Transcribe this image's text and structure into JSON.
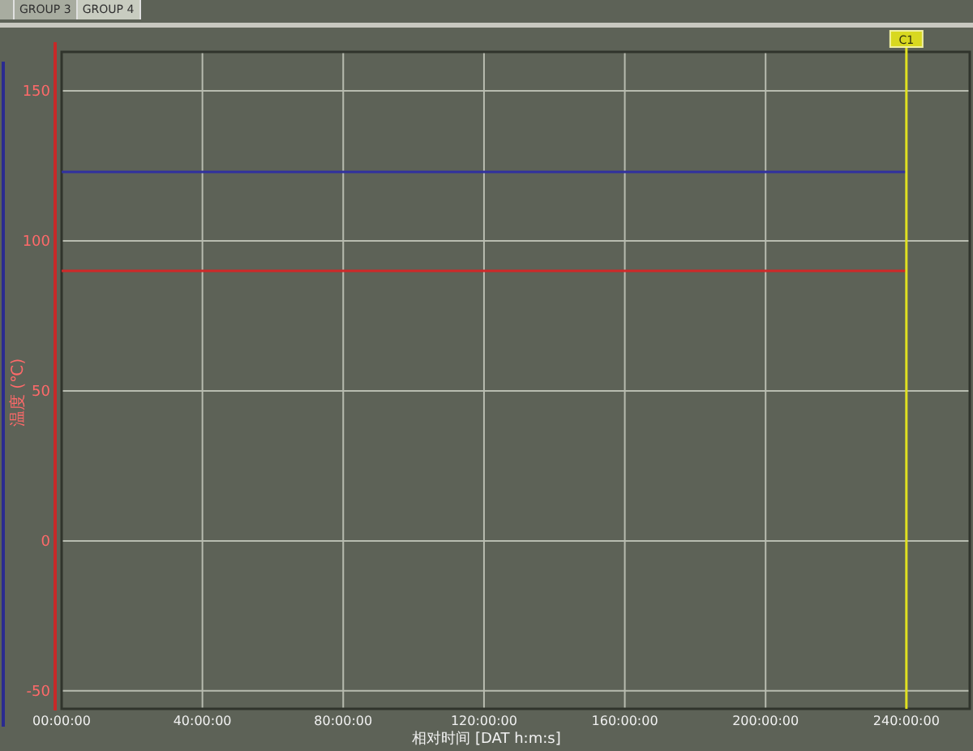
{
  "tabs": [
    {
      "selected": false
    },
    {
      "label": "GROUP 3",
      "selected": false
    },
    {
      "label": "GROUP 4",
      "selected": true
    }
  ],
  "chart": {
    "chart_data": {
      "type": "line",
      "grid": true,
      "xlabel": "相对时间 [DAT h:m:s]",
      "ylabel": "温度 (℃)",
      "x": [
        0,
        240
      ],
      "series": [
        {
          "color": "#3030a0",
          "values": [
            123,
            123
          ]
        },
        {
          "color": "#d02828",
          "values": [
            90,
            90
          ]
        }
      ],
      "xlim": [
        0,
        258
      ],
      "ylim": [
        -56,
        163
      ],
      "xticks": [
        {
          "value": 0,
          "label": "00:00:00"
        },
        {
          "value": 40,
          "label": "40:00:00"
        },
        {
          "value": 80,
          "label": "80:00:00"
        },
        {
          "value": 120,
          "label": "120:00:00"
        },
        {
          "value": 160,
          "label": "160:00:00"
        },
        {
          "value": 200,
          "label": "200:00:00"
        },
        {
          "value": 240,
          "label": "240:00:00"
        }
      ],
      "yticks": [
        -50,
        0,
        50,
        100,
        150
      ],
      "annotations": [
        {
          "x": 240,
          "text": "C1"
        }
      ]
    }
  }
}
